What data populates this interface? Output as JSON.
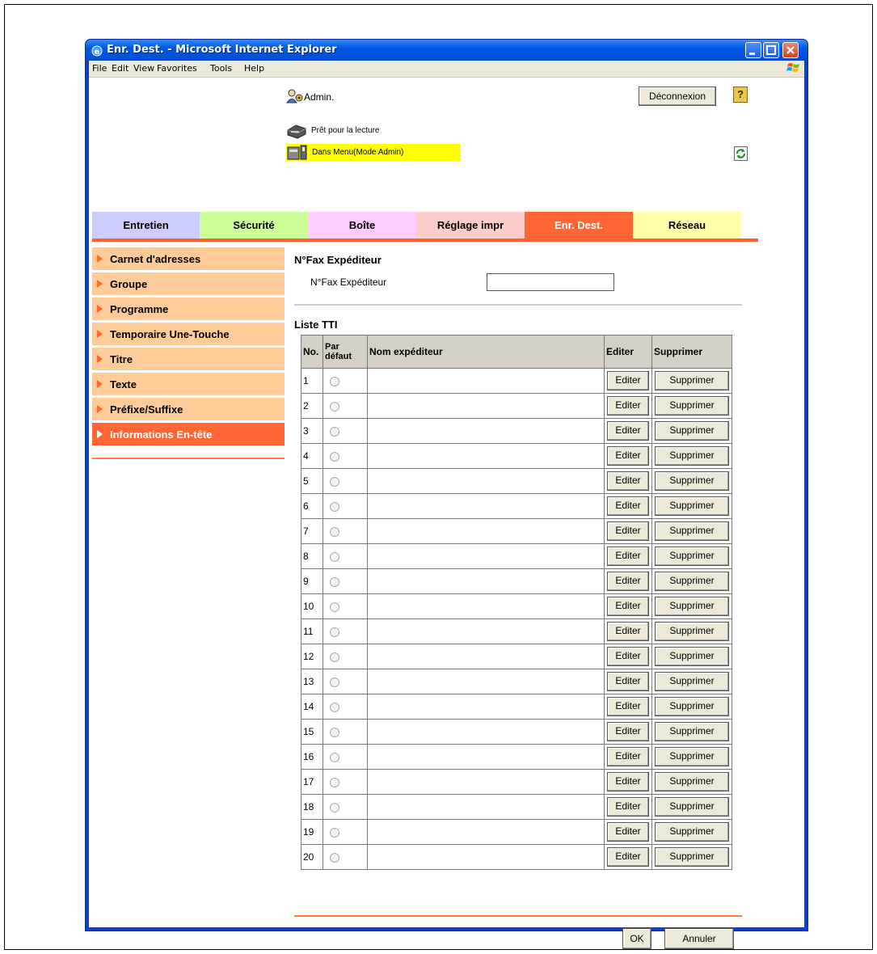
{
  "window": {
    "title": "Enr. Dest. - Microsoft Internet Explorer"
  },
  "menubar": [
    "File",
    "Edit",
    "View",
    "Favorites",
    "Tools",
    "Help"
  ],
  "header": {
    "user": "Admin.",
    "logout_label": "Déconnexion",
    "help_label": "?",
    "status_ready": "Prêt pour la lecture",
    "status_mode": "Dans Menu(Mode Admin)"
  },
  "tabs": [
    {
      "label": "Entretien",
      "color": "#ccccff"
    },
    {
      "label": "Sécurité",
      "color": "#ccff99"
    },
    {
      "label": "Boîte",
      "color": "#ffccff"
    },
    {
      "label": "Réglage impr",
      "color": "#ffcccc"
    },
    {
      "label": "Enr. Dest.",
      "color": "#ff6633",
      "active": true
    },
    {
      "label": "Réseau",
      "color": "#ffffaa"
    }
  ],
  "sidebar": [
    {
      "label": "Carnet d'adresses"
    },
    {
      "label": "Groupe"
    },
    {
      "label": "Programme"
    },
    {
      "label": "Temporaire Une-Touche"
    },
    {
      "label": "Titre"
    },
    {
      "label": "Texte"
    },
    {
      "label": "Préfixe/Suffixe"
    },
    {
      "label": "Informations En-tête",
      "active": true
    }
  ],
  "fax_section": {
    "title": "N°Fax Expéditeur",
    "field_label": "N°Fax Expéditeur",
    "field_value": ""
  },
  "tti": {
    "title": "Liste TTI",
    "headers": {
      "no": "No.",
      "default": "Par défaut",
      "name": "Nom expéditeur",
      "edit": "Editer",
      "delete": "Supprimer"
    },
    "edit_label": "Editer",
    "delete_label": "Supprimer",
    "rows": [
      {
        "no": "1",
        "name": ""
      },
      {
        "no": "2",
        "name": ""
      },
      {
        "no": "3",
        "name": ""
      },
      {
        "no": "4",
        "name": ""
      },
      {
        "no": "5",
        "name": ""
      },
      {
        "no": "6",
        "name": ""
      },
      {
        "no": "7",
        "name": ""
      },
      {
        "no": "8",
        "name": ""
      },
      {
        "no": "9",
        "name": ""
      },
      {
        "no": "10",
        "name": ""
      },
      {
        "no": "11",
        "name": ""
      },
      {
        "no": "12",
        "name": ""
      },
      {
        "no": "13",
        "name": ""
      },
      {
        "no": "14",
        "name": ""
      },
      {
        "no": "15",
        "name": ""
      },
      {
        "no": "16",
        "name": ""
      },
      {
        "no": "17",
        "name": ""
      },
      {
        "no": "18",
        "name": ""
      },
      {
        "no": "19",
        "name": ""
      },
      {
        "no": "20",
        "name": ""
      }
    ]
  },
  "footer": {
    "ok_label": "OK",
    "cancel_label": "Annuler"
  },
  "colors": {
    "accent": "#ff6633",
    "sidebar_bg": "#ffcc99",
    "mode_bar": "#ffff00",
    "xp_blue": "#0058e6"
  }
}
